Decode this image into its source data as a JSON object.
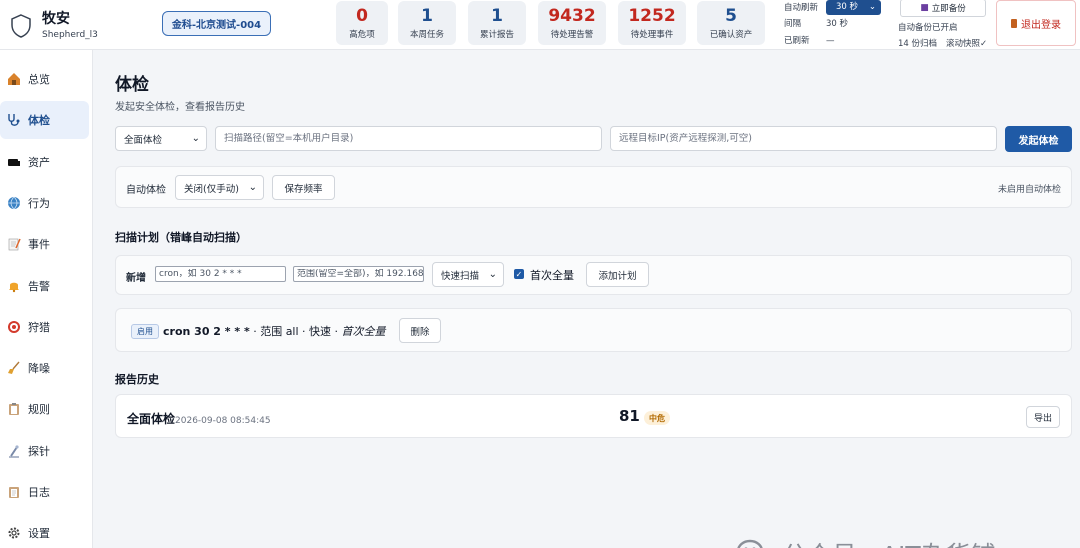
{
  "header": {
    "brand": {
      "title": "牧安",
      "subtitle": "Shepherd_l3"
    },
    "tenant": "金科-北京测试-004",
    "stats": [
      {
        "value": "0",
        "label": "高危项",
        "color": "red"
      },
      {
        "value": "1",
        "label": "本周任务",
        "color": "blue"
      },
      {
        "value": "1",
        "label": "累计报告",
        "color": "blue"
      },
      {
        "value": "9432",
        "label": "待处理告警",
        "color": "red"
      },
      {
        "value": "1252",
        "label": "待处理事件",
        "color": "red"
      },
      {
        "value": "5",
        "label": "已确认资产",
        "color": "blue"
      }
    ],
    "refresh": {
      "auto_label": "自动刷新",
      "auto_value": "30 秒",
      "interval_label": "间隔",
      "interval_value": "30 秒",
      "last_label": "已刷新",
      "last_value": "—"
    },
    "backup": {
      "button": "立即备份",
      "status": "自动备份已开启",
      "count": "14 份归档",
      "rolling": "滚动快照✓"
    },
    "logout": "退出登录"
  },
  "sidebar": {
    "items": [
      {
        "label": "总览",
        "icon": "house-icon",
        "active": false
      },
      {
        "label": "体检",
        "icon": "stethoscope-icon",
        "active": true
      },
      {
        "label": "资产",
        "icon": "server-icon",
        "active": false
      },
      {
        "label": "行为",
        "icon": "globe-icon",
        "active": false
      },
      {
        "label": "事件",
        "icon": "memo-icon",
        "active": false
      },
      {
        "label": "告警",
        "icon": "bell-icon",
        "active": false
      },
      {
        "label": "狩猎",
        "icon": "target-icon",
        "active": false
      },
      {
        "label": "降噪",
        "icon": "broom-icon",
        "active": false
      },
      {
        "label": "规则",
        "icon": "clipboard-icon",
        "active": false
      },
      {
        "label": "探针",
        "icon": "probe-icon",
        "active": false
      },
      {
        "label": "日志",
        "icon": "log-icon",
        "active": false
      },
      {
        "label": "设置",
        "icon": "gear-icon",
        "active": false
      }
    ]
  },
  "main": {
    "title": "体检",
    "subtitle": "发起安全体检，查看报告历史",
    "scan_form": {
      "type_value": "全面体检",
      "path_placeholder": "扫描路径(留空=本机用户目录)",
      "target_placeholder": "远程目标IP(资产远程探测,可空)",
      "start_button": "发起体检"
    },
    "auto_scan": {
      "label": "自动体检",
      "value": "关闭(仅手动)",
      "save_button": "保存频率",
      "status": "未启用自动体检"
    },
    "schedule": {
      "title": "扫描计划（错峰自动扫描）",
      "new_label": "新增",
      "cron_placeholder": "cron，如 30 2 * * *",
      "scope_placeholder": "范围(留空=全部)，如 192.168",
      "mode_value": "快速扫描",
      "full_first_label": "首次全量",
      "add_button": "添加计划",
      "plan": {
        "status": "启用",
        "cron": "cron 30 2 * * *",
        "detail": " · 范围 all · 快速 · ",
        "full_first": "首次全量",
        "delete_button": "删除"
      }
    },
    "history": {
      "title": "报告历史",
      "rows": [
        {
          "name": "全面体检",
          "time": "2026-09-08 08:54:45",
          "score": "81",
          "level": "中危",
          "export": "导出"
        }
      ]
    }
  },
  "watermark": "公众号 · AIT杂货铺"
}
